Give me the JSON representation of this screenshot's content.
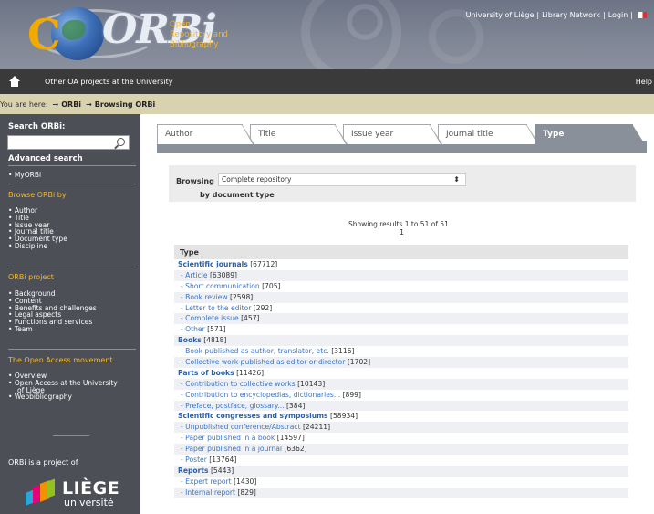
{
  "header": {
    "logo_text": "ORBi",
    "tagline": [
      "Open",
      "Repository and",
      "Bibliography"
    ],
    "top_links": [
      "University of Liège",
      "Library Network",
      "Login"
    ],
    "separator": "|"
  },
  "navbar": {
    "other_projects": "Other OA projects at the University",
    "help": "Help"
  },
  "breadcrumb": {
    "prefix": "You are here:",
    "items": [
      "ORBi",
      "Browsing ORBi"
    ]
  },
  "sidebar": {
    "search_title": "Search ORBi:",
    "search_value": "",
    "advanced": "Advanced search",
    "myorbi": "MyORBi",
    "browse_heading": "Browse ORBi by",
    "browse_items": [
      "Author",
      "Title",
      "Issue year",
      "Journal title",
      "Document type",
      "Discipline"
    ],
    "project_heading": "ORBi project",
    "project_items": [
      "Background",
      "Content",
      "Benefits and challenges",
      "Legal aspects",
      "Functions and services",
      "Team"
    ],
    "oa_heading": "The Open Access movement",
    "oa_items": [
      "Overview",
      "Open Access at the University",
      "Webbibliography"
    ],
    "oa_item_cont": "of Liège",
    "project_of": "ORBi is a project of",
    "liege_big": "LIÈGE",
    "liege_small": "université"
  },
  "tabs": [
    {
      "label": "Author",
      "active": false
    },
    {
      "label": "Title",
      "active": false
    },
    {
      "label": "Issue year",
      "active": false
    },
    {
      "label": "Journal title",
      "active": false
    },
    {
      "label": "Type",
      "active": true
    }
  ],
  "browse": {
    "label": "Browsing",
    "selected": "Complete repository",
    "by_label": "by document type",
    "showing": "Showing results 1 to 51 of 51",
    "page": "1"
  },
  "type_table": {
    "header": "Type",
    "rows": [
      {
        "kind": "cat",
        "label": "Scientific journals",
        "count": "[67712]"
      },
      {
        "kind": "sub",
        "label": "- Article",
        "count": "[63089]"
      },
      {
        "kind": "sub",
        "label": "- Short communication",
        "count": "[705]"
      },
      {
        "kind": "sub",
        "label": "- Book review",
        "count": "[2598]"
      },
      {
        "kind": "sub",
        "label": "- Letter to the editor",
        "count": "[292]"
      },
      {
        "kind": "sub",
        "label": "- Complete issue",
        "count": "[457]"
      },
      {
        "kind": "sub",
        "label": "- Other",
        "count": "[571]"
      },
      {
        "kind": "cat",
        "label": "Books",
        "count": "[4818]"
      },
      {
        "kind": "sub",
        "label": "- Book published as author, translator, etc.",
        "count": "[3116]"
      },
      {
        "kind": "sub",
        "label": "- Collective work published as editor or director",
        "count": "[1702]"
      },
      {
        "kind": "cat",
        "label": "Parts of books",
        "count": "[11426]"
      },
      {
        "kind": "sub",
        "label": "- Contribution to collective works",
        "count": "[10143]"
      },
      {
        "kind": "sub",
        "label": "- Contribution to encyclopedias, dictionaries...",
        "count": "[899]"
      },
      {
        "kind": "sub",
        "label": "- Preface, postface, glossary...",
        "count": "[384]"
      },
      {
        "kind": "cat",
        "label": "Scientific congresses and symposiums",
        "count": "[58934]"
      },
      {
        "kind": "sub",
        "label": "- Unpublished conference/Abstract",
        "count": "[24211]"
      },
      {
        "kind": "sub",
        "label": "- Paper published in a book",
        "count": "[14597]"
      },
      {
        "kind": "sub",
        "label": "- Paper published in a journal",
        "count": "[6362]"
      },
      {
        "kind": "sub",
        "label": "- Poster",
        "count": "[13764]"
      },
      {
        "kind": "cat",
        "label": "Reports",
        "count": "[5443]"
      },
      {
        "kind": "sub",
        "label": "- Expert report",
        "count": "[1430]"
      },
      {
        "kind": "sub",
        "label": "- Internal report",
        "count": "[829]"
      }
    ]
  }
}
